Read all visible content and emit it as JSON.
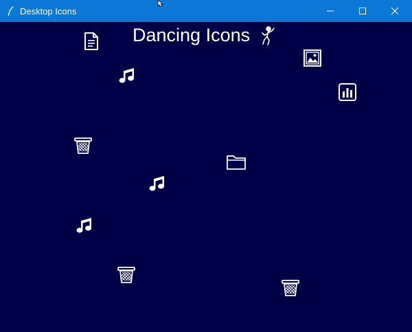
{
  "window": {
    "title": "Desktop Icons",
    "controls": [
      "minimize",
      "maximize",
      "close"
    ]
  },
  "canvas": {
    "background": "#000046",
    "heading": "Dancing Icons",
    "heading_icon": "dancer-icon"
  },
  "icons": [
    {
      "kind": "document-icon"
    },
    {
      "kind": "music-note-icon"
    },
    {
      "kind": "image-icon"
    },
    {
      "kind": "bar-chart-icon"
    },
    {
      "kind": "trash-icon"
    },
    {
      "kind": "folder-icon"
    },
    {
      "kind": "music-note-icon"
    },
    {
      "kind": "music-note-icon"
    },
    {
      "kind": "trash-icon"
    },
    {
      "kind": "trash-icon"
    }
  ],
  "colors": {
    "titlebar": "#0a78d4",
    "icon": "#ffffff"
  }
}
